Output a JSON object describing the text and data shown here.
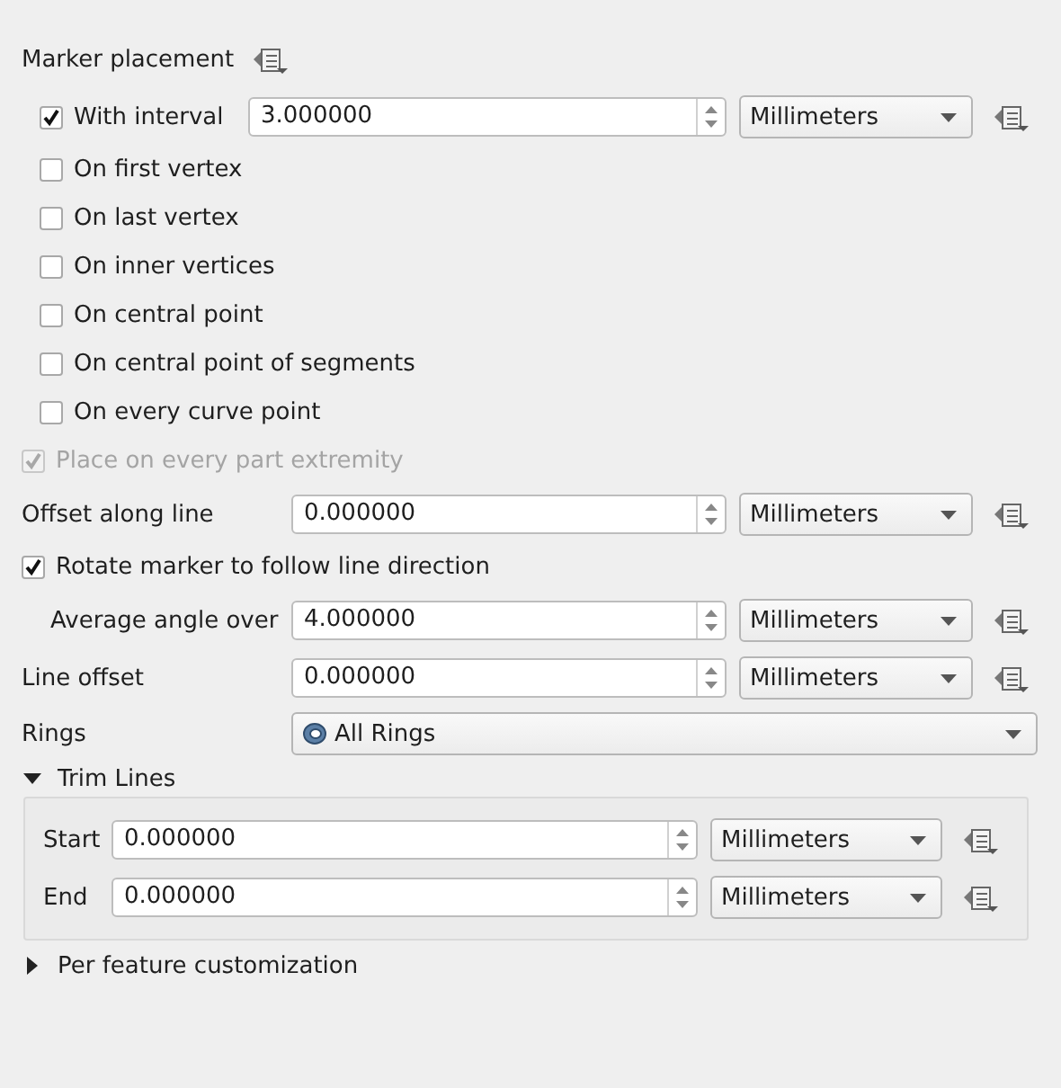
{
  "section": {
    "title": "Marker placement"
  },
  "placements": [
    {
      "kind": "interval",
      "label": "With interval",
      "checked": true,
      "disabled": false,
      "value": "3.000000",
      "unit": "Millimeters"
    },
    {
      "kind": "check",
      "label": "On first vertex",
      "checked": false,
      "disabled": false
    },
    {
      "kind": "check",
      "label": "On last vertex",
      "checked": false,
      "disabled": false
    },
    {
      "kind": "check",
      "label": "On inner vertices",
      "checked": false,
      "disabled": false
    },
    {
      "kind": "check",
      "label": "On central point",
      "checked": false,
      "disabled": false
    },
    {
      "kind": "check",
      "label": "On central point of segments",
      "checked": false,
      "disabled": false
    },
    {
      "kind": "check",
      "label": "On every curve point",
      "checked": false,
      "disabled": false
    },
    {
      "kind": "check",
      "label": "Place on every part extremity",
      "checked": true,
      "disabled": true
    }
  ],
  "offset_along_line": {
    "label": "Offset along line",
    "value": "0.000000",
    "unit": "Millimeters"
  },
  "rotate": {
    "label": "Rotate marker to follow line direction",
    "checked": true
  },
  "average_angle": {
    "label": "Average angle over",
    "value": "4.000000",
    "unit": "Millimeters"
  },
  "line_offset": {
    "label": "Line offset",
    "value": "0.000000",
    "unit": "Millimeters"
  },
  "rings": {
    "label": "Rings",
    "value": "All Rings"
  },
  "trim_lines": {
    "title": "Trim Lines",
    "expanded": true,
    "rows": [
      {
        "label": "Start",
        "value": "0.000000",
        "unit": "Millimeters"
      },
      {
        "label": "End",
        "value": "0.000000",
        "unit": "Millimeters"
      }
    ]
  },
  "per_feature": {
    "title": "Per feature customization",
    "expanded": false
  }
}
